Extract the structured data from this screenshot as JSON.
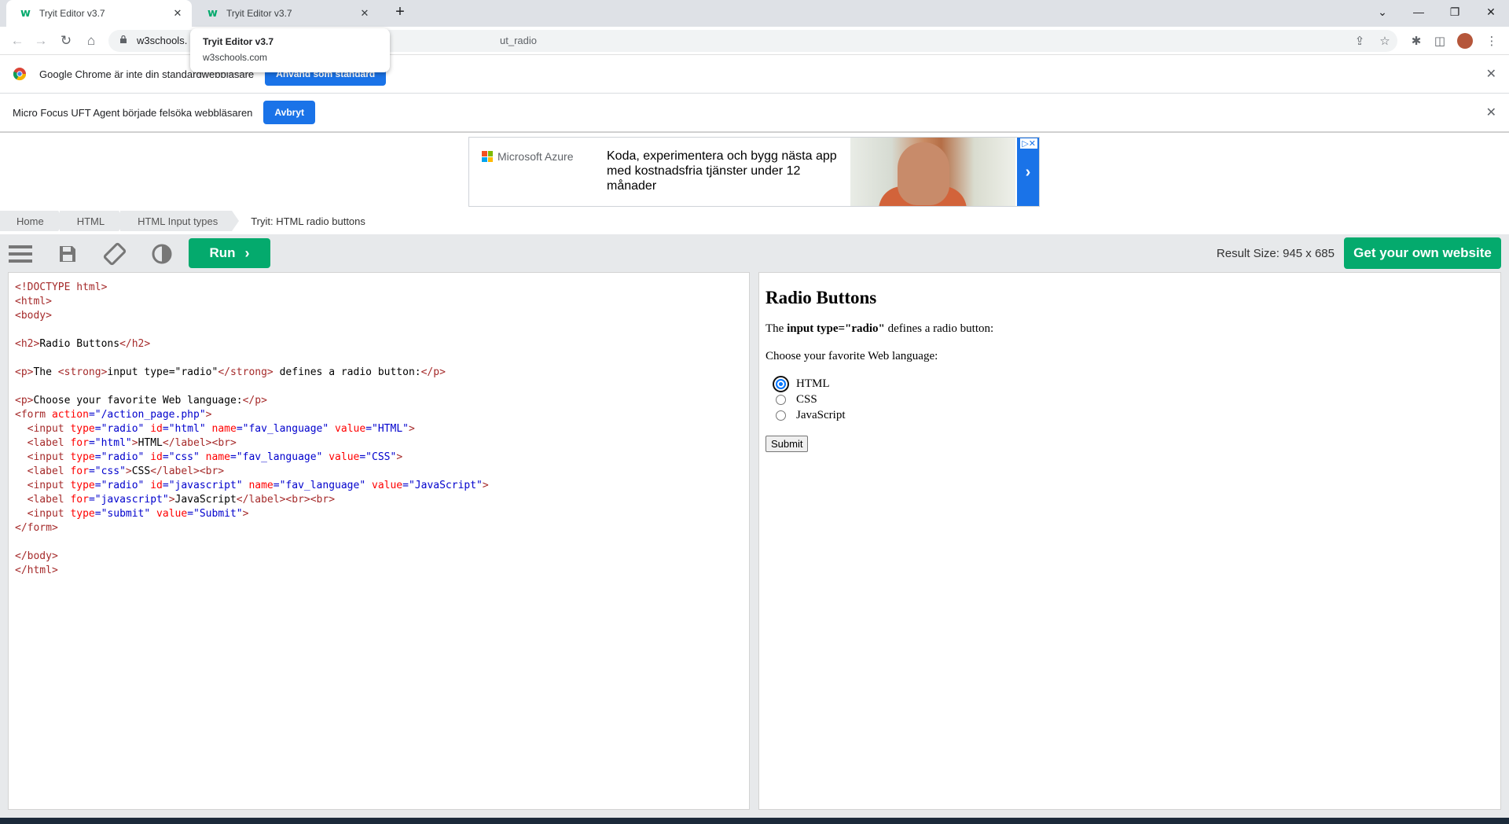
{
  "browser": {
    "tabs": [
      {
        "title": "Tryit Editor v3.7",
        "active": true
      },
      {
        "title": "Tryit Editor v3.7",
        "active": false
      }
    ],
    "tooltip": {
      "title": "Tryit Editor v3.7",
      "domain": "w3schools.com"
    },
    "url_visible": "w3schools.",
    "url_tail": "ut_radio"
  },
  "infobars": [
    {
      "message": "Google Chrome är inte din standardwebbläsare",
      "button": "Använd som standard"
    },
    {
      "message": "Micro Focus UFT Agent började felsöka webbläsaren",
      "button": "Avbryt"
    }
  ],
  "ad": {
    "brand": "Microsoft Azure",
    "copy": "Koda, experimentera och bygg nästa app med kostnadsfria tjänster under 12 månader",
    "adchoices": "▷✕",
    "next": "›"
  },
  "breadcrumb": [
    "Home",
    "HTML",
    "HTML Input types",
    "Tryit: HTML radio buttons"
  ],
  "trybar": {
    "run_label": "Run",
    "result_size": "Result Size: 945 x 685",
    "get_website": "Get your own website"
  },
  "result": {
    "heading": "Radio Buttons",
    "intro_pre": "The ",
    "intro_strong": "input type=\"radio\"",
    "intro_post": " defines a radio button:",
    "prompt": "Choose your favorite Web language:",
    "options": [
      {
        "label": "HTML",
        "checked": true
      },
      {
        "label": "CSS",
        "checked": false
      },
      {
        "label": "JavaScript",
        "checked": false
      }
    ],
    "submit": "Submit"
  }
}
